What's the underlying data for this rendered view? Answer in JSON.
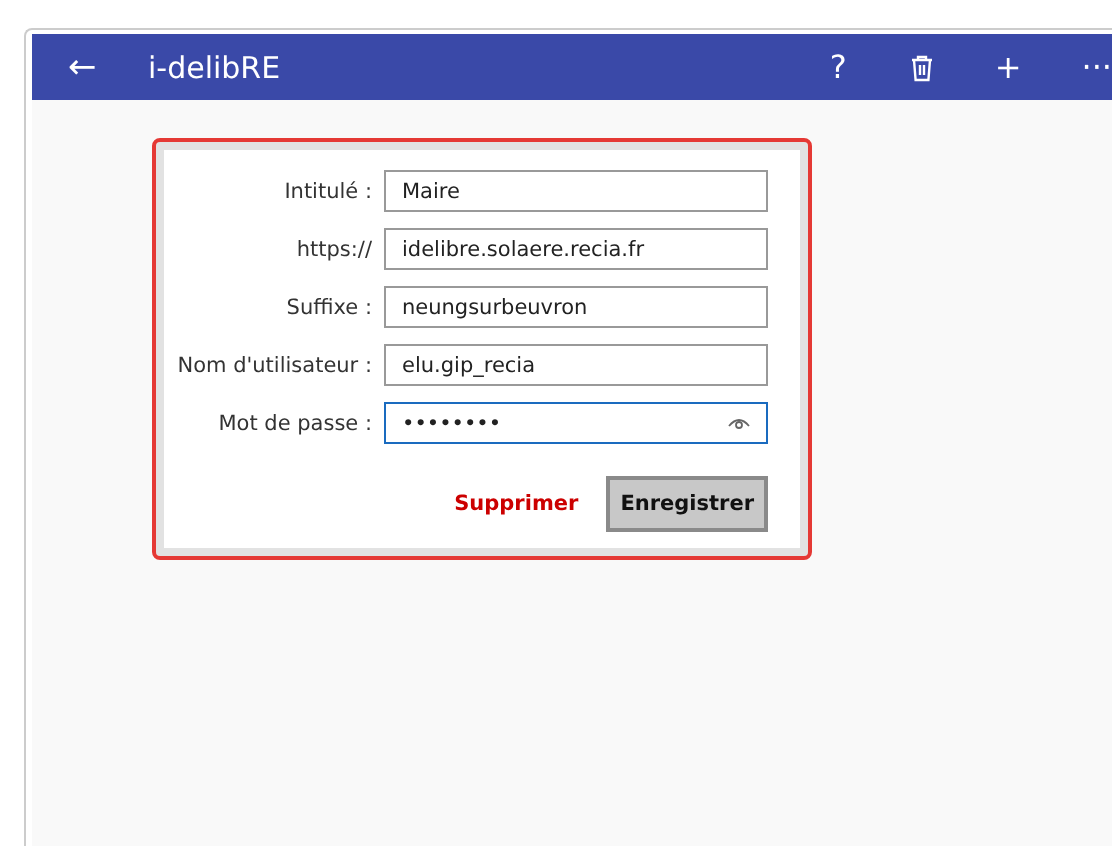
{
  "app_bar": {
    "back": "←",
    "title": "i-delibRE",
    "actions": [
      "?",
      "+",
      "···"
    ]
  },
  "form": {
    "fields": [
      {
        "label": "Intitulé :",
        "value": "Maire",
        "kind": "text",
        "focused": false
      },
      {
        "label": "https://",
        "value": "idelibre.solaere.recia.fr",
        "kind": "text",
        "focused": false
      },
      {
        "label": "Suffixe :",
        "value": "neungsurbeuvron",
        "kind": "text",
        "focused": false
      },
      {
        "label": "Nom d'utilisateur :",
        "value": "elu.gip_recia",
        "kind": "text",
        "focused": false
      },
      {
        "label": "Mot de passe :",
        "value": "••••••••",
        "kind": "password",
        "focused": true
      }
    ],
    "delete_button": "Supprimer",
    "save_button": "Enregistrer"
  }
}
